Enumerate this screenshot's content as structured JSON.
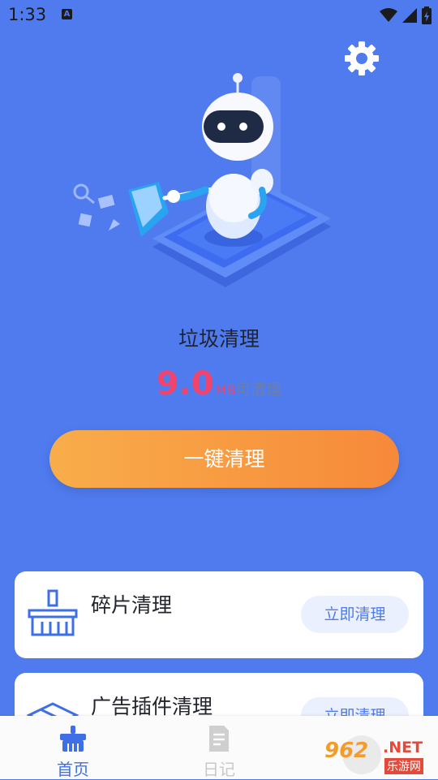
{
  "status": {
    "time": "1:33",
    "notification": "A"
  },
  "icons": {
    "settings": "gear-icon",
    "hero": "robot-cleaning-phone-illustration"
  },
  "main": {
    "title": "垃圾清理",
    "amount_value": "9.0",
    "amount_unit": "MB",
    "amount_suffix": "可清理",
    "clean_button": "一键清理"
  },
  "cards": [
    {
      "title": "碎片清理",
      "button": "立即清理",
      "icon": "broom-icon"
    },
    {
      "title": "广告插件清理",
      "button": "立即清理",
      "icon": "box-icon"
    }
  ],
  "tabs": [
    {
      "label": "首页",
      "icon": "home-icon",
      "active": true
    },
    {
      "label": "日记",
      "icon": "document-icon",
      "active": false
    }
  ],
  "watermark": {
    "brand": "962",
    "domain": ".NET",
    "name": "乐游网"
  },
  "colors": {
    "background": "#4f7bef",
    "accent": "#3f6fe6",
    "amount": "#f0446c",
    "button_start": "#f8ad4a",
    "button_end": "#f7893a"
  }
}
